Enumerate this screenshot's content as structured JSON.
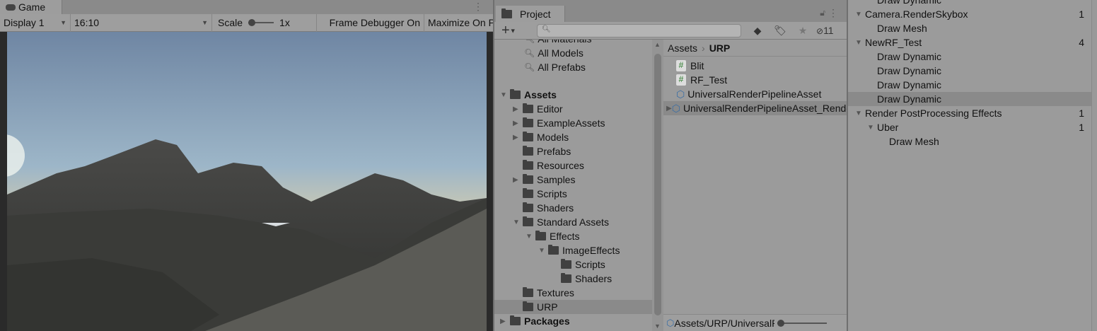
{
  "game": {
    "tab": "Game",
    "display": "Display 1",
    "aspect": "16:10",
    "scale_label": "Scale",
    "scale_value": "1x",
    "frame_debugger": "Frame Debugger On",
    "maximize": "Maximize On Play"
  },
  "project": {
    "tab": "Project",
    "hidden_count": "11",
    "search_placeholder": "",
    "favorites": [
      "All Materials",
      "All Models",
      "All Prefabs"
    ],
    "tree": [
      {
        "label": "Assets",
        "depth": 0,
        "open": true,
        "bold": true
      },
      {
        "label": "Editor",
        "depth": 1,
        "arrow": true
      },
      {
        "label": "ExampleAssets",
        "depth": 1,
        "arrow": true
      },
      {
        "label": "Models",
        "depth": 1,
        "arrow": true
      },
      {
        "label": "Prefabs",
        "depth": 1
      },
      {
        "label": "Resources",
        "depth": 1
      },
      {
        "label": "Samples",
        "depth": 1,
        "arrow": true
      },
      {
        "label": "Scripts",
        "depth": 1
      },
      {
        "label": "Shaders",
        "depth": 1
      },
      {
        "label": "Standard Assets",
        "depth": 1,
        "open": true
      },
      {
        "label": "Effects",
        "depth": 2,
        "open": true
      },
      {
        "label": "ImageEffects",
        "depth": 3,
        "open": true
      },
      {
        "label": "Scripts",
        "depth": 4
      },
      {
        "label": "Shaders",
        "depth": 4
      },
      {
        "label": "Textures",
        "depth": 1
      },
      {
        "label": "URP",
        "depth": 1,
        "selected": true
      },
      {
        "label": "Packages",
        "depth": 0,
        "arrow": true,
        "bold": true
      }
    ],
    "breadcrumb": [
      "Assets",
      "URP"
    ],
    "files": [
      {
        "label": "Blit",
        "type": "script"
      },
      {
        "label": "RF_Test",
        "type": "script"
      },
      {
        "label": "UniversalRenderPipelineAsset",
        "type": "asset"
      },
      {
        "label": "UniversalRenderPipelineAsset_Renderer",
        "type": "asset",
        "selected": true,
        "arrow": true
      }
    ],
    "status_path": "Assets/URP/UniversalRenderPipelineAsset_Renderer"
  },
  "frame_debugger": {
    "rows": [
      {
        "label": "Draw Dynamic",
        "depth": 1,
        "count": ""
      },
      {
        "label": "Camera.RenderSkybox",
        "depth": 0,
        "open": true,
        "count": "1"
      },
      {
        "label": "Draw Mesh",
        "depth": 1,
        "count": ""
      },
      {
        "label": "NewRF_Test",
        "depth": 0,
        "open": true,
        "count": "4"
      },
      {
        "label": "Draw Dynamic",
        "depth": 1,
        "count": ""
      },
      {
        "label": "Draw Dynamic",
        "depth": 1,
        "count": ""
      },
      {
        "label": "Draw Dynamic",
        "depth": 1,
        "count": ""
      },
      {
        "label": "Draw Dynamic",
        "depth": 1,
        "count": "",
        "selected": true
      },
      {
        "label": "Render PostProcessing Effects",
        "depth": 0,
        "open": true,
        "count": "1"
      },
      {
        "label": "Uber",
        "depth": 1,
        "open": true,
        "count": "1"
      },
      {
        "label": "Draw Mesh",
        "depth": 2,
        "count": ""
      }
    ]
  }
}
